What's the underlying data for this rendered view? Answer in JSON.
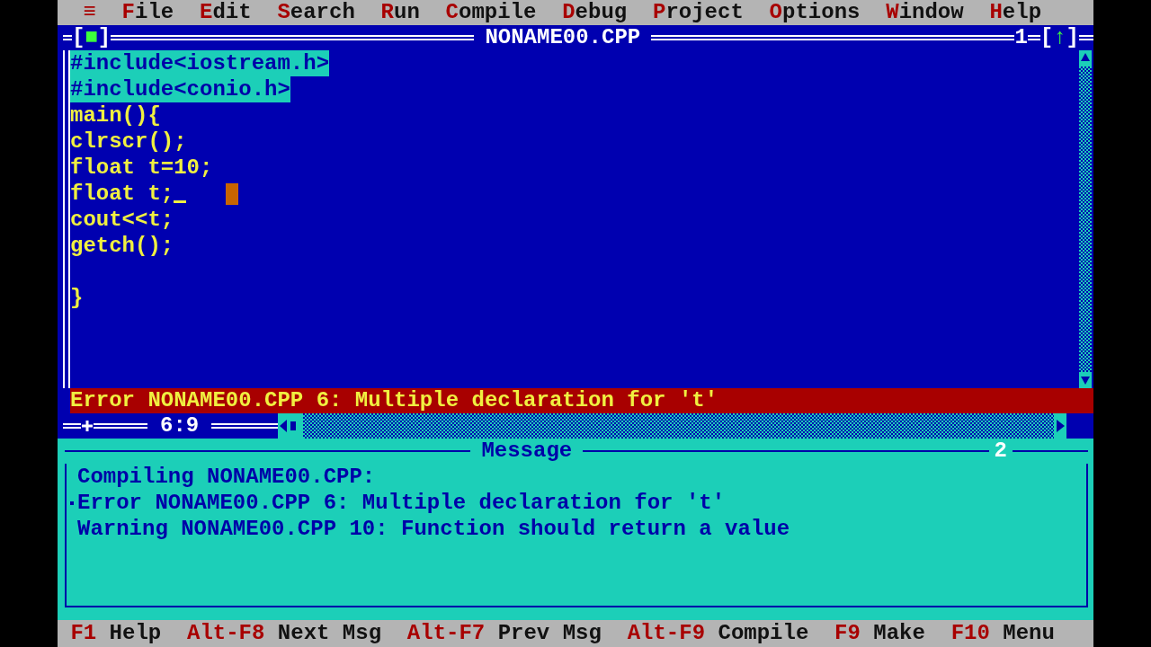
{
  "menu": [
    {
      "label": "≡"
    },
    {
      "label": "File"
    },
    {
      "label": "Edit"
    },
    {
      "label": "Search"
    },
    {
      "label": "Run"
    },
    {
      "label": "Compile"
    },
    {
      "label": "Debug"
    },
    {
      "label": "Project"
    },
    {
      "label": "Options"
    },
    {
      "label": "Window"
    },
    {
      "label": "Help"
    }
  ],
  "editor": {
    "close_box": "[■]",
    "title": "NONAME00.CPP",
    "window_number": "1",
    "zoom_box": "[↑]",
    "lines": [
      {
        "text": "#include<iostream.h>",
        "selected": true,
        "cursor": false
      },
      {
        "text": "#include<conio.h>",
        "selected": true,
        "cursor": false
      },
      {
        "text": "main(){",
        "selected": false,
        "cursor": false
      },
      {
        "text": "clrscr();",
        "selected": false,
        "cursor": false
      },
      {
        "text": "float t=10;",
        "selected": false,
        "cursor": false
      },
      {
        "text": "float t;",
        "selected": false,
        "cursor": true
      },
      {
        "text": "cout<<t;",
        "selected": false,
        "cursor": false
      },
      {
        "text": "getch();",
        "selected": false,
        "cursor": false
      },
      {
        "text": "}",
        "selected": false,
        "cursor": false,
        "blank_line_before": true
      }
    ],
    "error": "Error NONAME00.CPP 6: Multiple declaration for 't'",
    "position": "6:9"
  },
  "message": {
    "title": "Message",
    "window_number": "2",
    "lines": [
      {
        "text": "Compiling NONAME00.CPP:",
        "selected": false
      },
      {
        "text": "Error NONAME00.CPP 6: Multiple declaration for 't'",
        "selected": true
      },
      {
        "text": "Warning NONAME00.CPP 10: Function should return a value",
        "selected": false
      }
    ]
  },
  "status_bar": [
    {
      "key": "F1",
      "label": "Help"
    },
    {
      "key": "Alt-F8",
      "label": "Next Msg"
    },
    {
      "key": "Alt-F7",
      "label": "Prev Msg"
    },
    {
      "key": "Alt-F9",
      "label": "Compile"
    },
    {
      "key": "F9",
      "label": "Make"
    },
    {
      "key": "F10",
      "label": "Menu"
    }
  ]
}
